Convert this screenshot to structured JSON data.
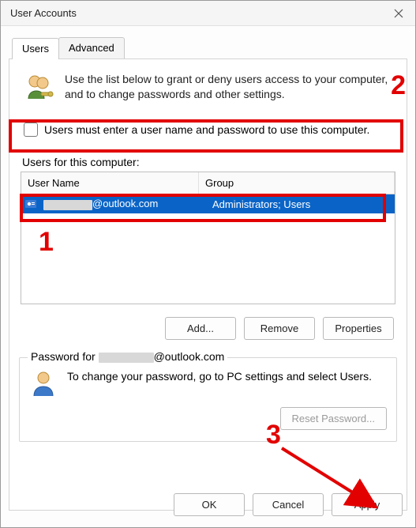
{
  "window": {
    "title": "User Accounts"
  },
  "tabs": {
    "users": "Users",
    "advanced": "Advanced"
  },
  "intro": {
    "text": "Use the list below to grant or deny users access to your computer, and to change passwords and other settings."
  },
  "checkbox": {
    "label": "Users must enter a user name and password to use this computer.",
    "checked": false
  },
  "users": {
    "header_label": "Users for this computer:",
    "columns": {
      "user": "User Name",
      "group": "Group"
    },
    "rows": [
      {
        "user_prefix": "",
        "user_suffix": "@outlook.com",
        "group": "Administrators; Users",
        "selected": true
      }
    ]
  },
  "buttons": {
    "add": "Add...",
    "remove": "Remove",
    "properties": "Properties"
  },
  "password_group": {
    "legend_prefix": "Password for ",
    "legend_suffix": "@outlook.com",
    "text": "To change your password, go to PC settings and select Users.",
    "reset": "Reset Password..."
  },
  "dialog_buttons": {
    "ok": "OK",
    "cancel": "Cancel",
    "apply": "Apply"
  },
  "annotations": {
    "n1": "1",
    "n2": "2",
    "n3": "3"
  },
  "colors": {
    "selection_bg": "#0a64c7",
    "annotation": "#e20000"
  }
}
